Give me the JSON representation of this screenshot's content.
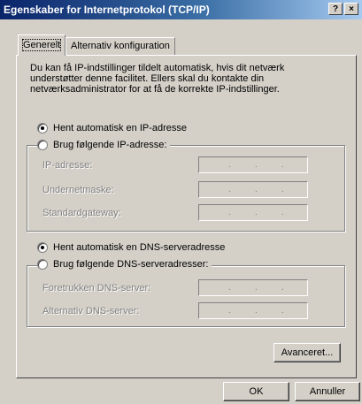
{
  "window": {
    "title": "Egenskaber for Internetprotokol (TCP/IP)",
    "help_button": "?",
    "close_button": "×"
  },
  "tabs": [
    {
      "label": "Generelt",
      "active": true
    },
    {
      "label": "Alternativ konfiguration",
      "active": false
    }
  ],
  "description": "Du kan få IP-indstillinger tildelt automatisk, hvis dit netværk understøtter denne facilitet. Ellers skal du kontakte din netværksadministrator for at få de korrekte IP-indstillinger.",
  "ip_section": {
    "auto_label": "Hent automatisk en IP-adresse",
    "auto_selected": true,
    "manual_label": "Brug følgende IP-adresse:",
    "manual_selected": false,
    "fields": [
      {
        "label": "IP-adresse:",
        "value": ""
      },
      {
        "label": "Undernetmaske:",
        "value": ""
      },
      {
        "label": "Standardgateway:",
        "value": ""
      }
    ]
  },
  "dns_section": {
    "auto_label": "Hent automatisk en DNS-serveradresse",
    "auto_selected": true,
    "manual_label": "Brug følgende DNS-serveradresser:",
    "manual_selected": false,
    "fields": [
      {
        "label": "Foretrukken DNS-server:",
        "value": ""
      },
      {
        "label": "Alternativ DNS-server:",
        "value": ""
      }
    ]
  },
  "buttons": {
    "advanced": "Avanceret...",
    "ok": "OK",
    "cancel": "Annuller"
  },
  "colors": {
    "face": "#d4d0c8",
    "title_start": "#0a246a",
    "title_end": "#a6caf0",
    "disabled_text": "#808080"
  }
}
